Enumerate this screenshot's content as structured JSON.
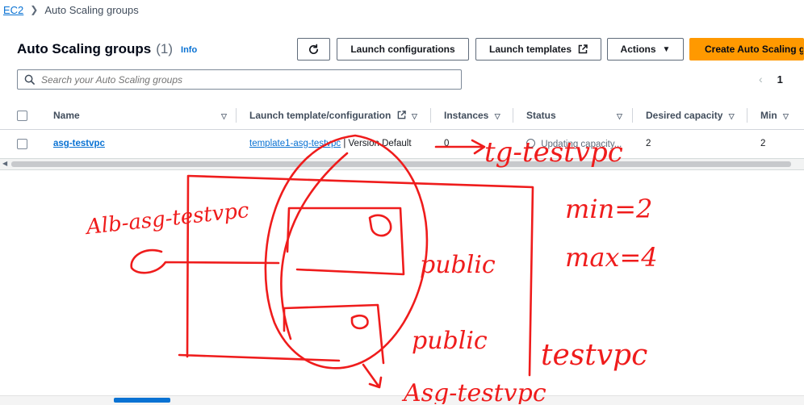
{
  "breadcrumb": {
    "root": "EC2",
    "current": "Auto Scaling groups"
  },
  "header": {
    "title": "Auto Scaling groups",
    "count": "(1)",
    "info": "Info"
  },
  "toolbar": {
    "launch_configurations": "Launch configurations",
    "launch_templates": "Launch templates",
    "actions": "Actions",
    "create": "Create Auto Scaling g"
  },
  "search": {
    "placeholder": "Search your Auto Scaling groups"
  },
  "pager": {
    "prev": "‹",
    "page": "1"
  },
  "table": {
    "columns": {
      "name": "Name",
      "launch": "Launch template/configuration",
      "instances": "Instances",
      "status": "Status",
      "desired": "Desired capacity",
      "min": "Min"
    },
    "rows": [
      {
        "name": "asg-testvpc",
        "template": "template1-asg-testvpc",
        "version": "| Version Default",
        "instances": "0",
        "status": "Updating capacity...",
        "desired": "2",
        "min": "2"
      }
    ]
  },
  "annotations": {
    "tg": "tg-testvpc",
    "min": "min=2",
    "max": "max=4",
    "alb": "Alb-asg-testvpc",
    "public1": "public",
    "public2": "public",
    "testvpc": "testvpc",
    "asg": "Asg-testvpc",
    "ink_color": "#ef1c1c"
  }
}
